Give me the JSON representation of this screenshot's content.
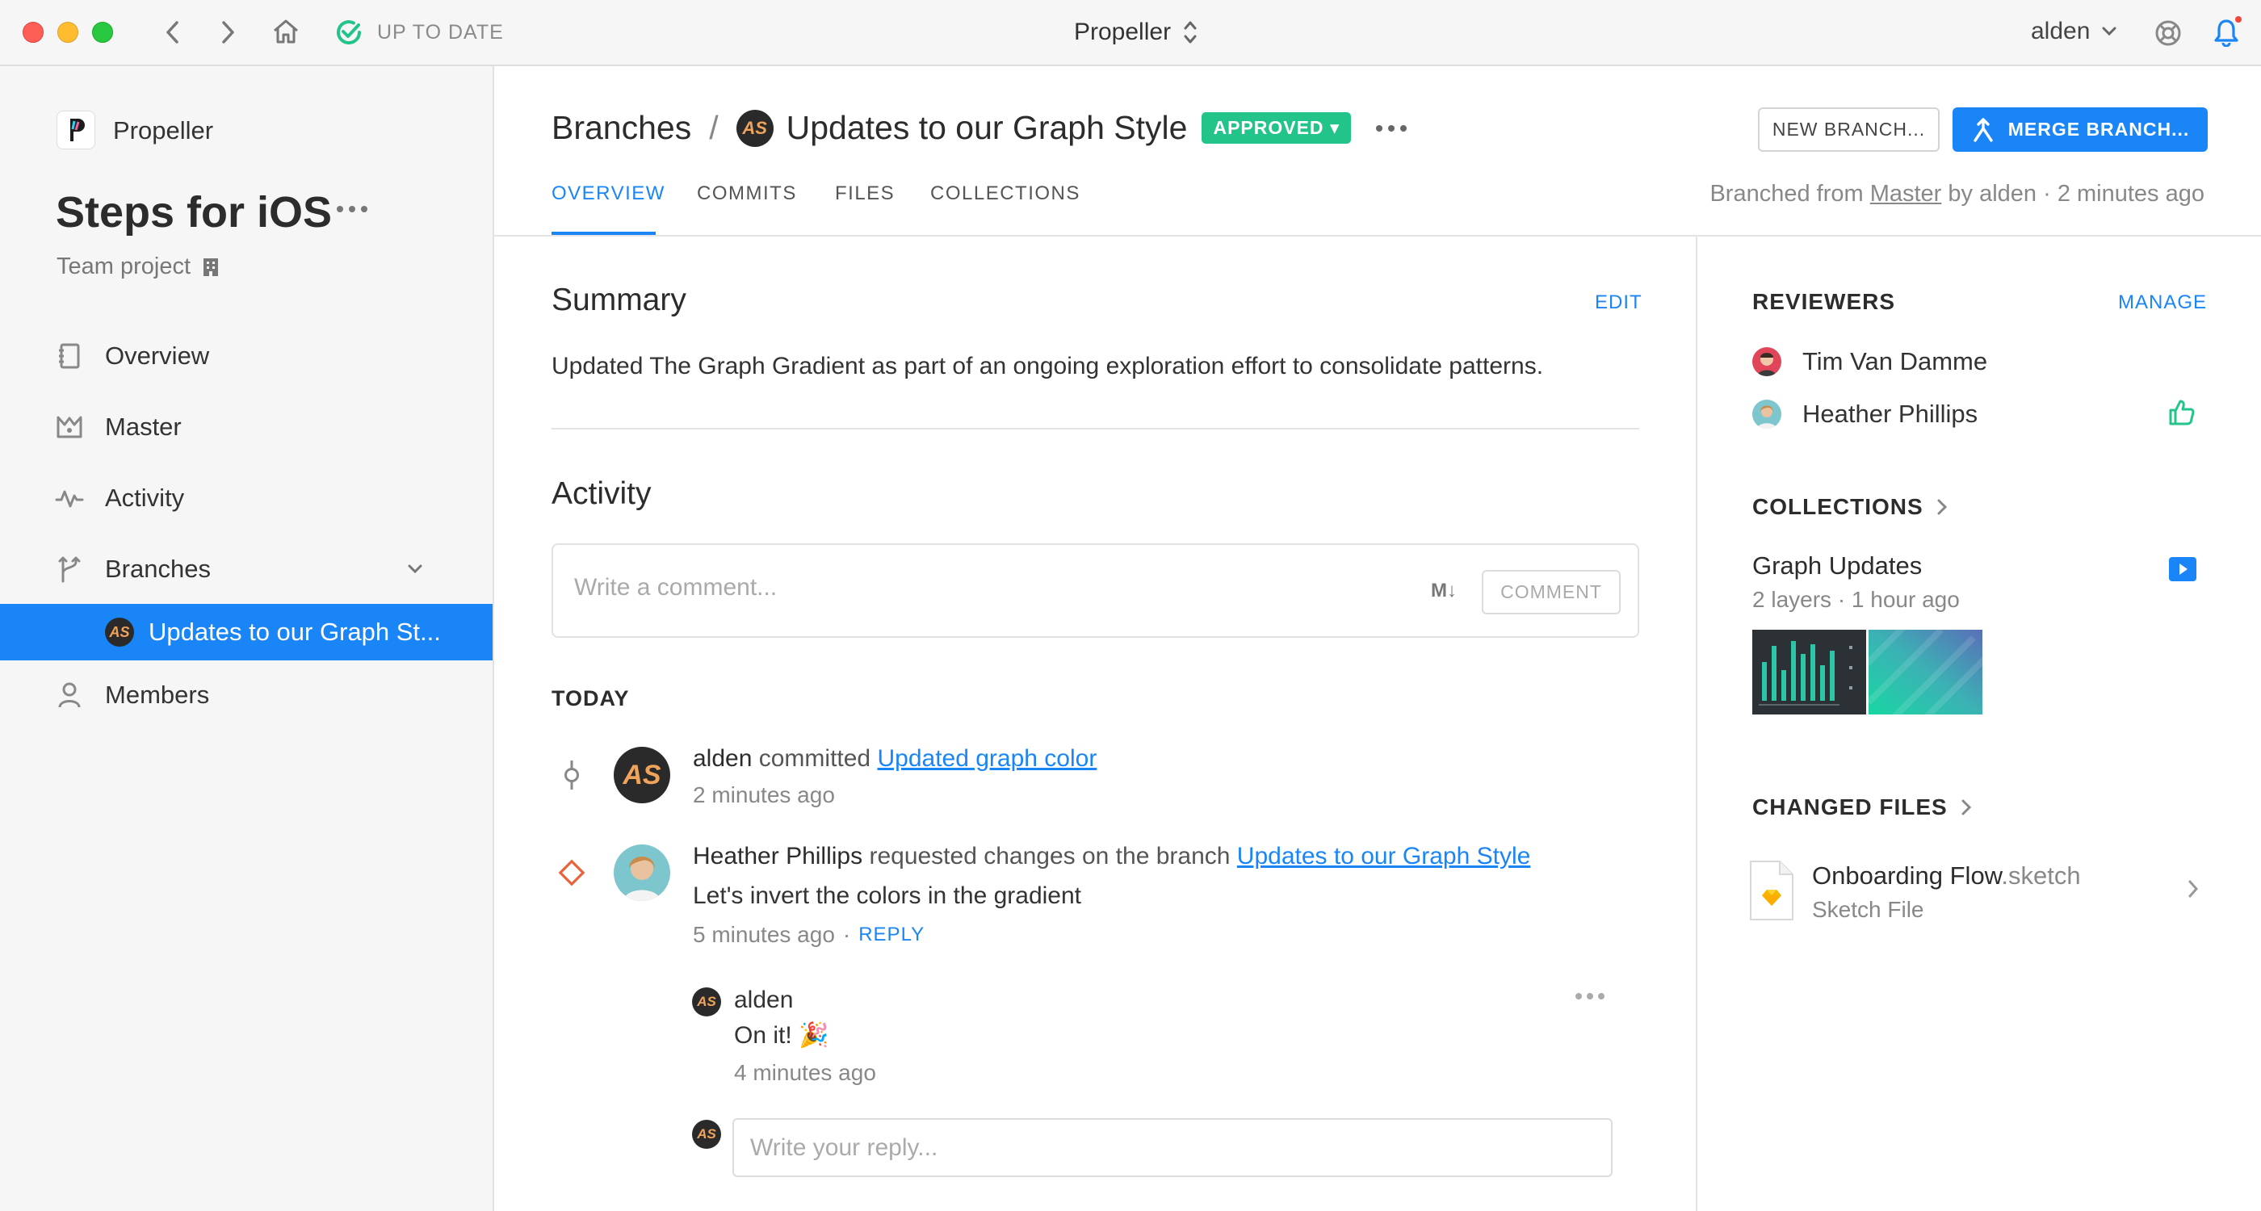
{
  "titlebar": {
    "status": "UP TO DATE",
    "app_title": "Propeller",
    "user": "alden"
  },
  "sidebar": {
    "project_name": "Propeller",
    "space_title": "Steps for iOS",
    "space_subtitle": "Team project",
    "items": [
      {
        "label": "Overview",
        "icon": "notebook-icon"
      },
      {
        "label": "Master",
        "icon": "crown-icon"
      },
      {
        "label": "Activity",
        "icon": "activity-icon"
      },
      {
        "label": "Branches",
        "icon": "branch-icon"
      },
      {
        "label": "Updates to our Graph St...",
        "icon": "avatar"
      },
      {
        "label": "Members",
        "icon": "person-icon"
      }
    ]
  },
  "header": {
    "breadcrumb_root": "Branches",
    "separator": "/",
    "branch_title": "Updates to our Graph Style",
    "badge": "APPROVED ▾",
    "new_branch": "NEW BRANCH...",
    "merge_branch": "MERGE BRANCH...",
    "tabs": [
      "OVERVIEW",
      "COMMITS",
      "FILES",
      "COLLECTIONS"
    ],
    "branched_prefix": "Branched from",
    "branched_link": "Master",
    "branched_suffix": "by alden · 2 minutes ago"
  },
  "summary": {
    "title": "Summary",
    "edit": "EDIT",
    "text": "Updated The Graph Gradient as part of an ongoing exploration effort to consolidate patterns."
  },
  "activity": {
    "title": "Activity",
    "comment_placeholder": "Write a comment...",
    "markdown_icon": "M↓",
    "comment_button": "COMMENT",
    "today": "TODAY",
    "entries": [
      {
        "author": "alden",
        "action": "committed",
        "link": "Updated graph color",
        "time": "2 minutes ago"
      },
      {
        "author": "Heather Phillips",
        "action": "requested changes on the branch",
        "link": "Updates to our Graph Style",
        "message": "Let's invert the colors in the gradient",
        "time": "5 minutes ago",
        "dot": "·",
        "reply": "REPLY"
      }
    ],
    "reply": {
      "author": "alden",
      "message": "On it! 🎉",
      "time": "4 minutes ago"
    },
    "reply_placeholder": "Write your reply..."
  },
  "right": {
    "reviewers_title": "REVIEWERS",
    "manage": "MANAGE",
    "reviewers": [
      "Tim Van Damme",
      "Heather Phillips"
    ],
    "collections_title": "COLLECTIONS",
    "collection_name": "Graph Updates",
    "collection_meta": "2 layers · 1 hour ago",
    "changed_files_title": "CHANGED FILES",
    "file_name": "Onboarding Flow",
    "file_ext": ".sketch",
    "file_type": "Sketch File"
  },
  "colors": {
    "accent": "#1a85f6",
    "approved": "#23c48a",
    "change_request": "#e8623c"
  }
}
